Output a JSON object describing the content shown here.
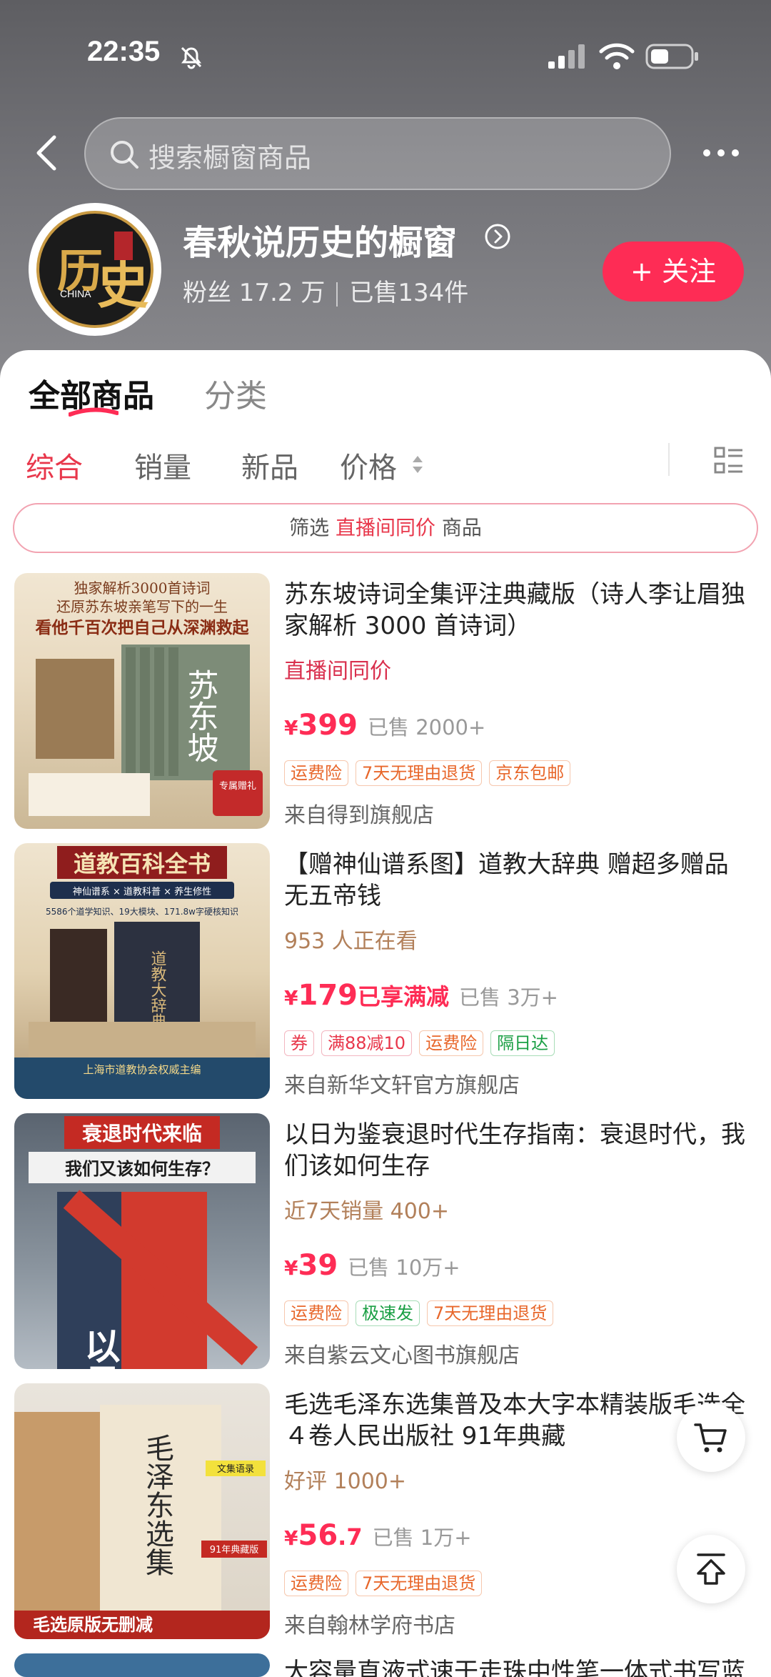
{
  "status": {
    "time": "22:35"
  },
  "header": {
    "search_placeholder": "搜索橱窗商品"
  },
  "shop": {
    "name": "春秋说历史的橱窗",
    "fans": "粉丝 17.2 万",
    "sold": "已售134件",
    "follow_label": "+ 关注"
  },
  "tabs": {
    "all": "全部商品",
    "category": "分类"
  },
  "sort": [
    "综合",
    "销量",
    "新品",
    "价格"
  ],
  "filter": {
    "prefix": "筛选 ",
    "highlight": "直播间同价",
    "suffix": " 商品"
  },
  "products": [
    {
      "title": "苏东坡诗词全集评注典藏版（诗人李让眉独家解析 3000 首诗词）",
      "tag": "直播间同价",
      "price_symbol": "¥",
      "price": "399",
      "price_extra": "",
      "sold": "已售 2000+",
      "chips": [
        "运费险",
        "7天无理由退货",
        "京东包邮"
      ],
      "store": "来自得到旗舰店",
      "thumb_top": "独家解析3000首诗词",
      "thumb_line2": "还原苏东坡亲笔写下的一生",
      "thumb_line3": "看他千百次把自己从深渊救起",
      "thumb_main": "苏东坡",
      "thumb_badge": "专属赠礼"
    },
    {
      "title": "【赠神仙谱系图】道教大辞典 赠超多赠品 无五帝钱",
      "tag": "953 人正在看",
      "price_symbol": "¥",
      "price": "179",
      "price_extra": "已享满减",
      "sold": "已售 3万+",
      "chips": [
        "券",
        "满88减10",
        "运费险",
        "隔日达"
      ],
      "store": "来自新华文轩官方旗舰店",
      "thumb_top": "道教百科全书",
      "thumb_line2": "神仙谱系 × 道教科普 × 养生修性",
      "thumb_line3": "5586个道学知识、19大模块、171.8w字硬核知识",
      "thumb_main": "道教大辞典",
      "thumb_badge": "上海市道教协会权威主编"
    },
    {
      "title": "以日为鉴衰退时代生存指南：衰退时代，我们该如何生存",
      "tag": "近7天销量 400+",
      "price_symbol": "¥",
      "price": "39",
      "price_extra": "",
      "sold": "已售 10万+",
      "chips": [
        "运费险",
        "极速发",
        "7天无理由退货"
      ],
      "store": "来自紫云文心图书旗舰店",
      "thumb_top": "衰退时代来临",
      "thumb_line2": "我们又该如何生存？",
      "thumb_line3": "",
      "thumb_main": "以日为鉴",
      "thumb_badge": ""
    },
    {
      "title": "毛选毛泽东选集普及本大字本精装版毛选全４卷人民出版社 91年典藏",
      "tag": "好评 1000+",
      "price_symbol": "¥",
      "price": "56",
      "price_extra": ".7",
      "sold": "已售 1万+",
      "chips": [
        "运费险",
        "7天无理由退货"
      ],
      "store": "来自翰林学府书店",
      "thumb_top": "",
      "thumb_line2": "毛泽东选集",
      "thumb_line3": "文集语录",
      "thumb_main": "毛选原版无删减",
      "thumb_badge": "91年典藏版"
    }
  ],
  "next_title": "大容量直液式速干走珠中性笔一体式书写蓝",
  "colors": {
    "accent": "#fe2c55",
    "header_bg": "#6b6b70"
  }
}
